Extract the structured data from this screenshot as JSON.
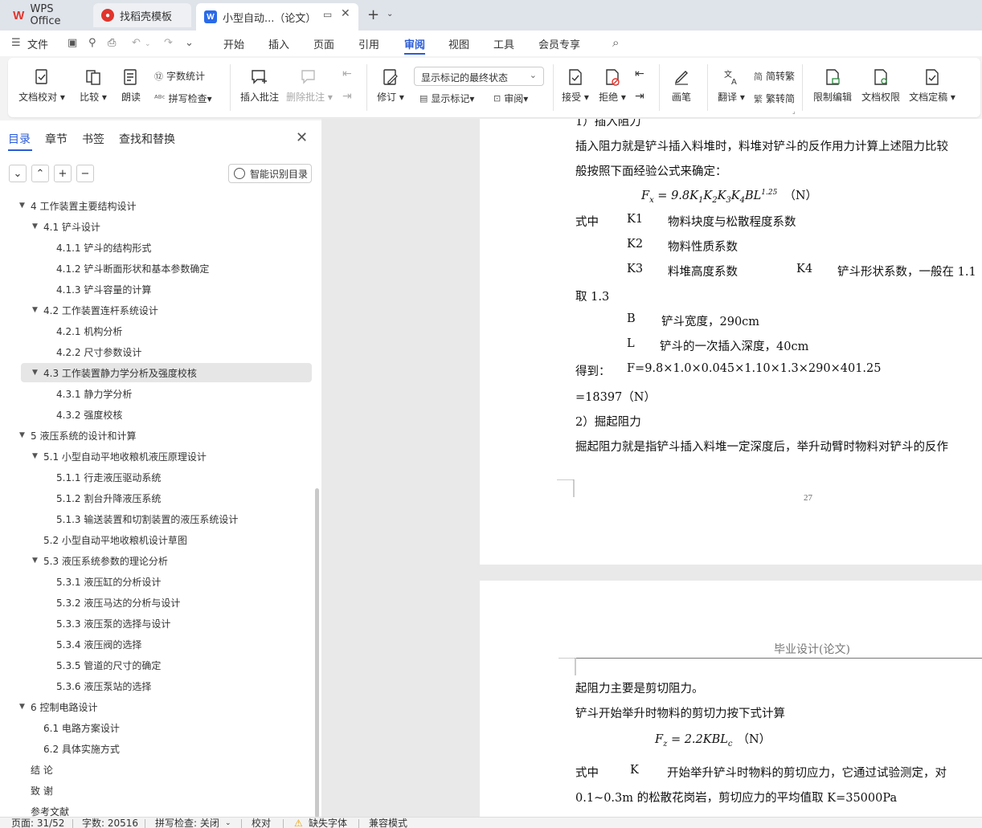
{
  "tabs": {
    "wps": "WPS Office",
    "template": "找稻壳模板",
    "doc": "小型自动...（论文）"
  },
  "menu": {
    "file": "文件",
    "items": [
      "开始",
      "插入",
      "页面",
      "引用",
      "审阅",
      "视图",
      "工具",
      "会员专享"
    ]
  },
  "ribbon": {
    "doc_proof": "文档校对",
    "compare": "比较",
    "read_aloud": "朗读",
    "word_count": "字数统计",
    "spell_check": "拼写检查",
    "insert_comment": "插入批注",
    "delete_comment": "删除批注",
    "track_changes": "修订",
    "markup_state": "显示标记的最终状态",
    "show_markup": "显示标记",
    "review_pane": "审阅",
    "accept": "接受",
    "reject": "拒绝",
    "ink": "画笔",
    "translate": "翻译",
    "to_traditional": "简转繁",
    "to_simplified": "繁转简",
    "restrict_edit": "限制编辑",
    "doc_permission": "文档权限",
    "finalize": "文档定稿"
  },
  "nav": {
    "tabs": [
      "目录",
      "章节",
      "书签",
      "查找和替换"
    ],
    "smart_toc": "智能识别目录",
    "toc": [
      {
        "label": "4  工作装置主要结构设计",
        "level": 1,
        "exp": "▼"
      },
      {
        "label": "4.1  铲斗设计",
        "level": 2,
        "exp": "▼"
      },
      {
        "label": "4.1.1  铲斗的结构形式",
        "level": 3,
        "exp": ""
      },
      {
        "label": "4.1.2  铲斗断面形状和基本参数确定",
        "level": 3,
        "exp": ""
      },
      {
        "label": "4.1.3  铲斗容量的计算",
        "level": 3,
        "exp": ""
      },
      {
        "label": "4.2  工作装置连杆系统设计",
        "level": 2,
        "exp": "▼"
      },
      {
        "label": "4.2.1  机构分析",
        "level": 3,
        "exp": ""
      },
      {
        "label": "4.2.2  尺寸参数设计",
        "level": 3,
        "exp": ""
      },
      {
        "label": "4.3  工作装置静力学分析及强度校核",
        "level": 2,
        "exp": "▼",
        "active": true
      },
      {
        "label": "4.3.1  静力学分析",
        "level": 3,
        "exp": ""
      },
      {
        "label": "4.3.2  强度校核",
        "level": 3,
        "exp": ""
      },
      {
        "label": "5  液压系统的设计和计算",
        "level": 1,
        "exp": "▼"
      },
      {
        "label": "5.1  小型自动平地收粮机液压原理设计",
        "level": 2,
        "exp": "▼"
      },
      {
        "label": "5.1.1  行走液压驱动系统",
        "level": 3,
        "exp": ""
      },
      {
        "label": "5.1.2  割台升降液压系统",
        "level": 3,
        "exp": ""
      },
      {
        "label": "5.1.3  输送装置和切割装置的液压系统设计",
        "level": 3,
        "exp": ""
      },
      {
        "label": "5.2  小型自动平地收粮机设计草图",
        "level": 2,
        "exp": ""
      },
      {
        "label": "5.3  液压系统参数的理论分析",
        "level": 2,
        "exp": "▼"
      },
      {
        "label": "5.3.1  液压缸的分析设计",
        "level": 3,
        "exp": ""
      },
      {
        "label": "5.3.2  液压马达的分析与设计",
        "level": 3,
        "exp": ""
      },
      {
        "label": "5.3.3  液压泵的选择与设计",
        "level": 3,
        "exp": ""
      },
      {
        "label": "5.3.4  液压阀的选择",
        "level": 3,
        "exp": ""
      },
      {
        "label": "5.3.5  管道的尺寸的确定",
        "level": 3,
        "exp": ""
      },
      {
        "label": "5.3.6  液压泵站的选择",
        "level": 3,
        "exp": ""
      },
      {
        "label": "6  控制电路设计",
        "level": 1,
        "exp": "▼"
      },
      {
        "label": "6.1 电路方案设计",
        "level": 2,
        "exp": ""
      },
      {
        "label": "6.2 具体实施方式",
        "level": 2,
        "exp": ""
      },
      {
        "label": "结    论",
        "level": 1,
        "exp": ""
      },
      {
        "label": "致    谢",
        "level": 1,
        "exp": ""
      },
      {
        "label": "参考文献",
        "level": 1,
        "exp": ""
      }
    ]
  },
  "page1": {
    "lines": [
      "1）插入阻力",
      "插入阻力就是铲斗插入料堆时，料堆对铲斗的反作用力计算上述阻力比较",
      "般按照下面经验公式来确定：",
      "式中",
      "K1",
      "物料块度与松散程度系数",
      "K2",
      "物料性质系数",
      "K3",
      "料堆高度系数",
      "K4",
      "铲斗形状系数，一般在 1.1",
      "取 1.3",
      "B",
      "铲斗宽度，290cm",
      "L",
      "铲斗的一次插入深度，40cm",
      "得到：",
      "F=9.8×1.0×0.045×1.10×1.3×290×401.25",
      "=18397（N）",
      "2）掘起阻力",
      "掘起阻力就是指铲斗插入料堆一定深度后，举升动臂时物料对铲斗的反作"
    ],
    "formula_main": "F",
    "formula_sub": "x",
    "formula_rhs": " = 9.8K",
    "formula_tail": "BL",
    "formula_exp": "1.25",
    "formula_unit": "（N）",
    "k_subs": [
      "1",
      "2",
      "3",
      "4"
    ],
    "k_letter": "K",
    "page_number": "27"
  },
  "page2": {
    "header": "毕业设计(论文)",
    "lines": [
      "起阻力主要是剪切阻力。",
      "铲斗开始举升时物料的剪切力按下式计算",
      "式中",
      "K",
      "开始举升铲斗时物料的剪切应力，它通过试验测定，对",
      "0.1~0.3m 的松散花岗岩，剪切应力的平均值取 K=35000Pa"
    ],
    "formula_main": "F",
    "formula_sub": "z",
    "formula_rhs": " = 2.2KBL",
    "formula_rhs_sub": "c",
    "formula_unit": "（N）"
  },
  "status": {
    "page": "页面: 31/52",
    "words": "字数: 20516",
    "spell": "拼写检查: 关闭",
    "proof": "校对",
    "missing_font": "缺失字体",
    "compat": "兼容模式"
  }
}
